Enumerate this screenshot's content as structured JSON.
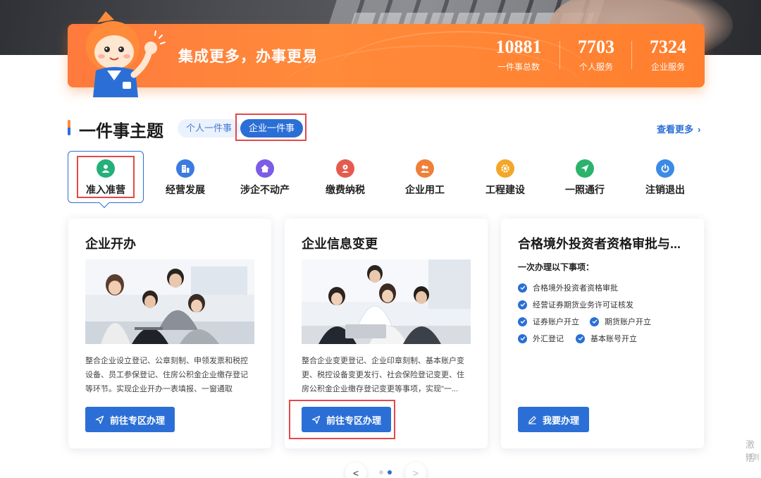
{
  "banner": {
    "slogan": "集成更多，办事更易",
    "stats": [
      {
        "value": "10881",
        "label": "一件事总数"
      },
      {
        "value": "7703",
        "label": "个人服务"
      },
      {
        "value": "7324",
        "label": "企业服务"
      }
    ]
  },
  "section": {
    "title": "一件事主题",
    "tabs": [
      {
        "label": "个人一件事",
        "active": false
      },
      {
        "label": "企业一件事",
        "active": true
      }
    ],
    "more_label": "查看更多"
  },
  "categories": [
    {
      "label": "准入准营",
      "icon": "person-icon",
      "color": "#23b07a",
      "active": true
    },
    {
      "label": "经营发展",
      "icon": "building-icon",
      "color": "#3b7be0",
      "active": false
    },
    {
      "label": "涉企不动产",
      "icon": "house-icon",
      "color": "#7b5ce6",
      "active": false
    },
    {
      "label": "缴费纳税",
      "icon": "tax-icon",
      "color": "#e65a4e",
      "active": false
    },
    {
      "label": "企业用工",
      "icon": "worker-icon",
      "color": "#f07f3a",
      "active": false
    },
    {
      "label": "工程建设",
      "icon": "gear-icon",
      "color": "#f2a72a",
      "active": false
    },
    {
      "label": "一照通行",
      "icon": "send-icon",
      "color": "#2bb36b",
      "active": false
    },
    {
      "label": "注销退出",
      "icon": "power-icon",
      "color": "#3b8ae6",
      "active": false
    }
  ],
  "cards": [
    {
      "title": "企业开办",
      "description": "整合企业设立登记、公章刻制、申领发票和税控设备、员工参保登记、住房公积金企业缴存登记等环节。实现企业开办一表填报、一窗通取",
      "button": "前往专区办理"
    },
    {
      "title": "企业信息变更",
      "description": "整合企业变更登记、企业印章刻制、基本账户变更、税控设备变更发行、社会保险登记变更、住房公积金企业缴存登记变更等事项，实现\"一...",
      "button": "前往专区办理"
    },
    {
      "title": "合格境外投资者资格审批与...",
      "subtitle": "一次办理以下事项：",
      "items": [
        "合格境外投资者资格审批",
        "经营证券期货业务许可证核发",
        "证券账户开立",
        "期货账户开立",
        "外汇登记",
        "基本账号开立"
      ],
      "button": "我要办理"
    }
  ],
  "pager": {
    "prev": "<",
    "next": ">"
  },
  "watermark": {
    "line1": "激活",
    "line2": "转到"
  },
  "colors": {
    "primary": "#2b6fd6",
    "accent": "#ff7f2e",
    "highlight": "#e3484a"
  }
}
